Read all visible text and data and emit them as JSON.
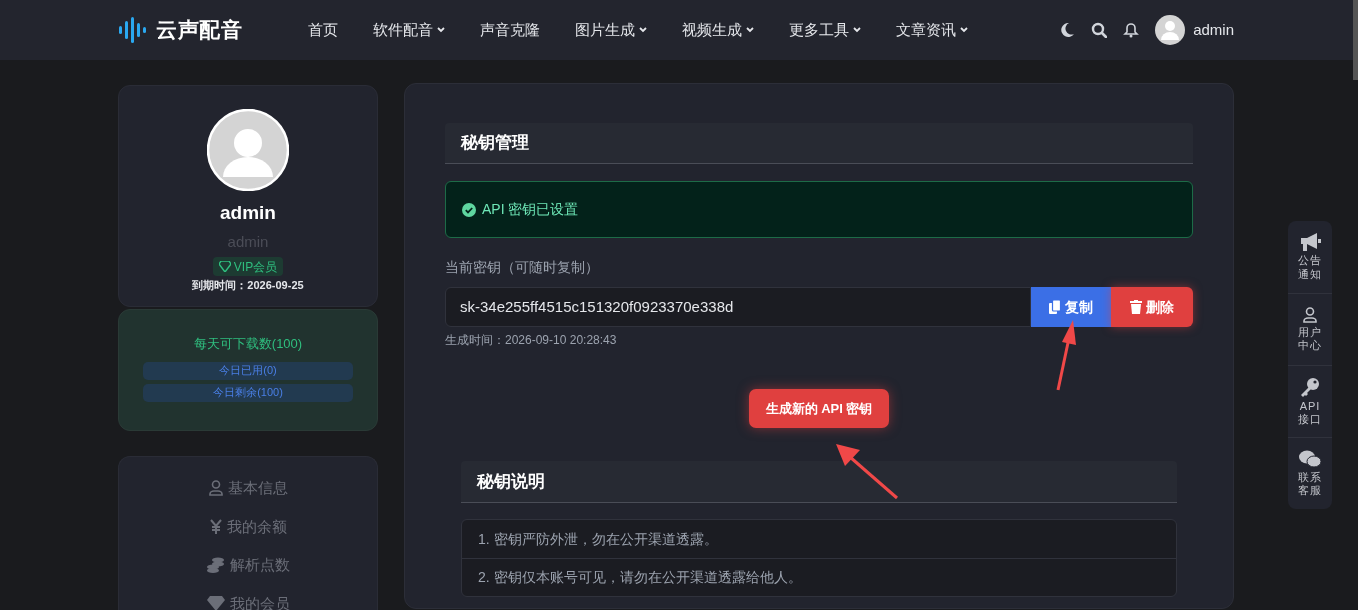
{
  "header": {
    "logo": "云声配音",
    "nav": [
      {
        "label": "首页",
        "dropdown": false
      },
      {
        "label": "软件配音",
        "dropdown": true
      },
      {
        "label": "声音克隆",
        "dropdown": false
      },
      {
        "label": "图片生成",
        "dropdown": true
      },
      {
        "label": "视频生成",
        "dropdown": true
      },
      {
        "label": "更多工具",
        "dropdown": true
      },
      {
        "label": "文章资讯",
        "dropdown": true
      }
    ],
    "username": "admin"
  },
  "profile": {
    "name": "admin",
    "subname": "admin",
    "badge": "VIP会员",
    "expiry": "到期时间：2026-09-25"
  },
  "downloads": {
    "title": "每天可下载数(100)",
    "used": "今日已用(0)",
    "remaining": "今日剩余(100)"
  },
  "menu": [
    {
      "kind": "user",
      "label": "基本信息"
    },
    {
      "kind": "yen",
      "label": "我的余额"
    },
    {
      "kind": "coins",
      "label": "解析点数"
    },
    {
      "kind": "gem",
      "label": "我的会员"
    }
  ],
  "key_section": {
    "title": "秘钥管理",
    "alert": "API 密钥已设置",
    "field_label": "当前密钥（可随时复制）",
    "key_value": "sk-34e255ff4515c151320f0923370e338d",
    "copy_button": "复制",
    "delete_button": "删除",
    "created": "生成时间：2026-09-10 20:28:43",
    "generate_button": "生成新的 API 密钥"
  },
  "notes_section": {
    "title": "秘钥说明",
    "items": [
      "1. 密钥严防外泄，勿在公开渠道透露。",
      "2. 密钥仅本账号可见，请勿在公开渠道透露给他人。"
    ]
  },
  "float_bar": [
    {
      "kind": "megaphone",
      "label": "公告通知"
    },
    {
      "kind": "user",
      "label": "用户中心"
    },
    {
      "kind": "key",
      "label": "API接口"
    },
    {
      "kind": "chat",
      "label": "联系客服"
    }
  ]
}
